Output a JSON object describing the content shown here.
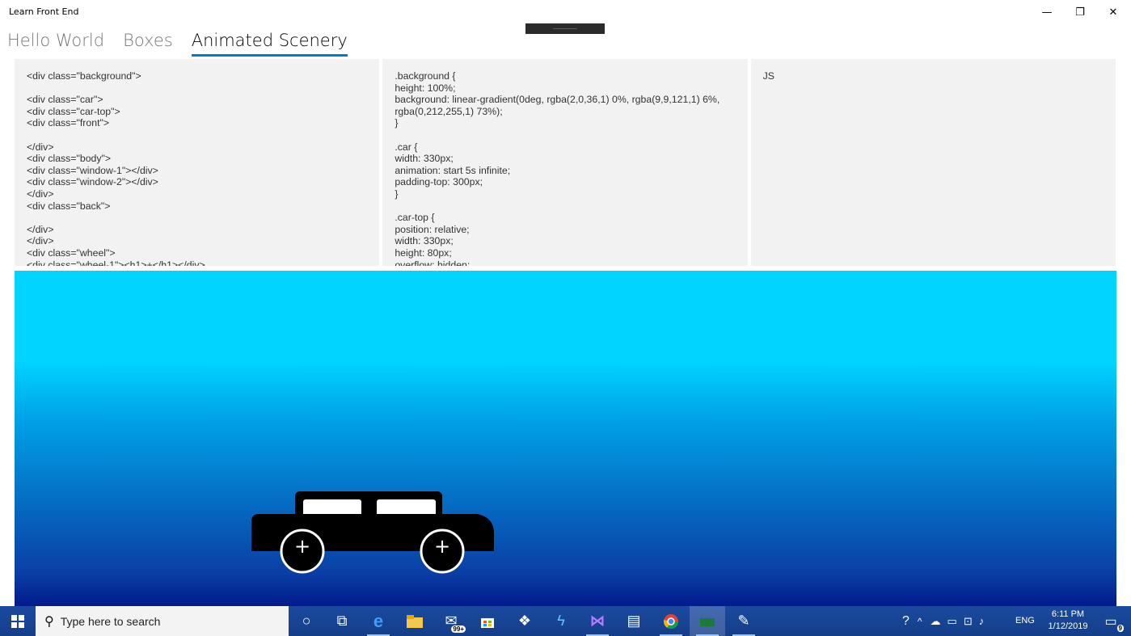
{
  "window": {
    "title": "Learn Front End",
    "minimize_glyph": "—",
    "maximize_glyph": "❐",
    "close_glyph": "✕"
  },
  "tabs": [
    {
      "label": "Hello World",
      "active": false
    },
    {
      "label": "Boxes",
      "active": false
    },
    {
      "label": "Animated Scenery",
      "active": true
    }
  ],
  "editors": {
    "html": "<div class=\"background\">\n\n<div class=\"car\">\n<div class=\"car-top\">\n<div class=\"front\">\n\n</div>\n<div class=\"body\">\n<div class=\"window-1\"></div>\n<div class=\"window-2\"></div>\n</div>\n<div class=\"back\">\n\n</div>\n</div>\n<div class=\"wheel\">\n<div class=\"wheel-1\"><h1>+</h1></div>",
    "css": ".background {\nheight: 100%;\nbackground: linear-gradient(0deg, rgba(2,0,36,1) 0%, rgba(9,9,121,1) 6%,\nrgba(0,212,255,1) 73%);\n}\n\n.car {\nwidth: 330px;\nanimation: start 5s infinite;\npadding-top: 300px;\n}\n\n.car-top {\nposition: relative;\nwidth: 330px;\nheight: 80px;\noverflow: hidden;",
    "js": "JS"
  },
  "scene": {
    "wheel_glyph": "+",
    "colors": {
      "sky_top": "#00d4ff",
      "sky_bottom": "#021a8c",
      "car": "#000000",
      "window": "#ffffff"
    }
  },
  "taskbar": {
    "search_placeholder": "Type here to search",
    "mail_badge": "99+",
    "language": "ENG",
    "time": "6:11 PM",
    "date": "1/12/2019",
    "notification_count": "9",
    "icons": [
      "windows-start-icon",
      "search-icon",
      "cortana-icon",
      "task-view-icon",
      "edge-icon",
      "file-explorer-icon",
      "mail-icon",
      "store-icon",
      "dropbox-icon",
      "visual-studio-code-icon",
      "visual-studio-icon",
      "printer-app-icon",
      "chrome-icon",
      "learn-front-end-icon",
      "paint-icon"
    ]
  }
}
